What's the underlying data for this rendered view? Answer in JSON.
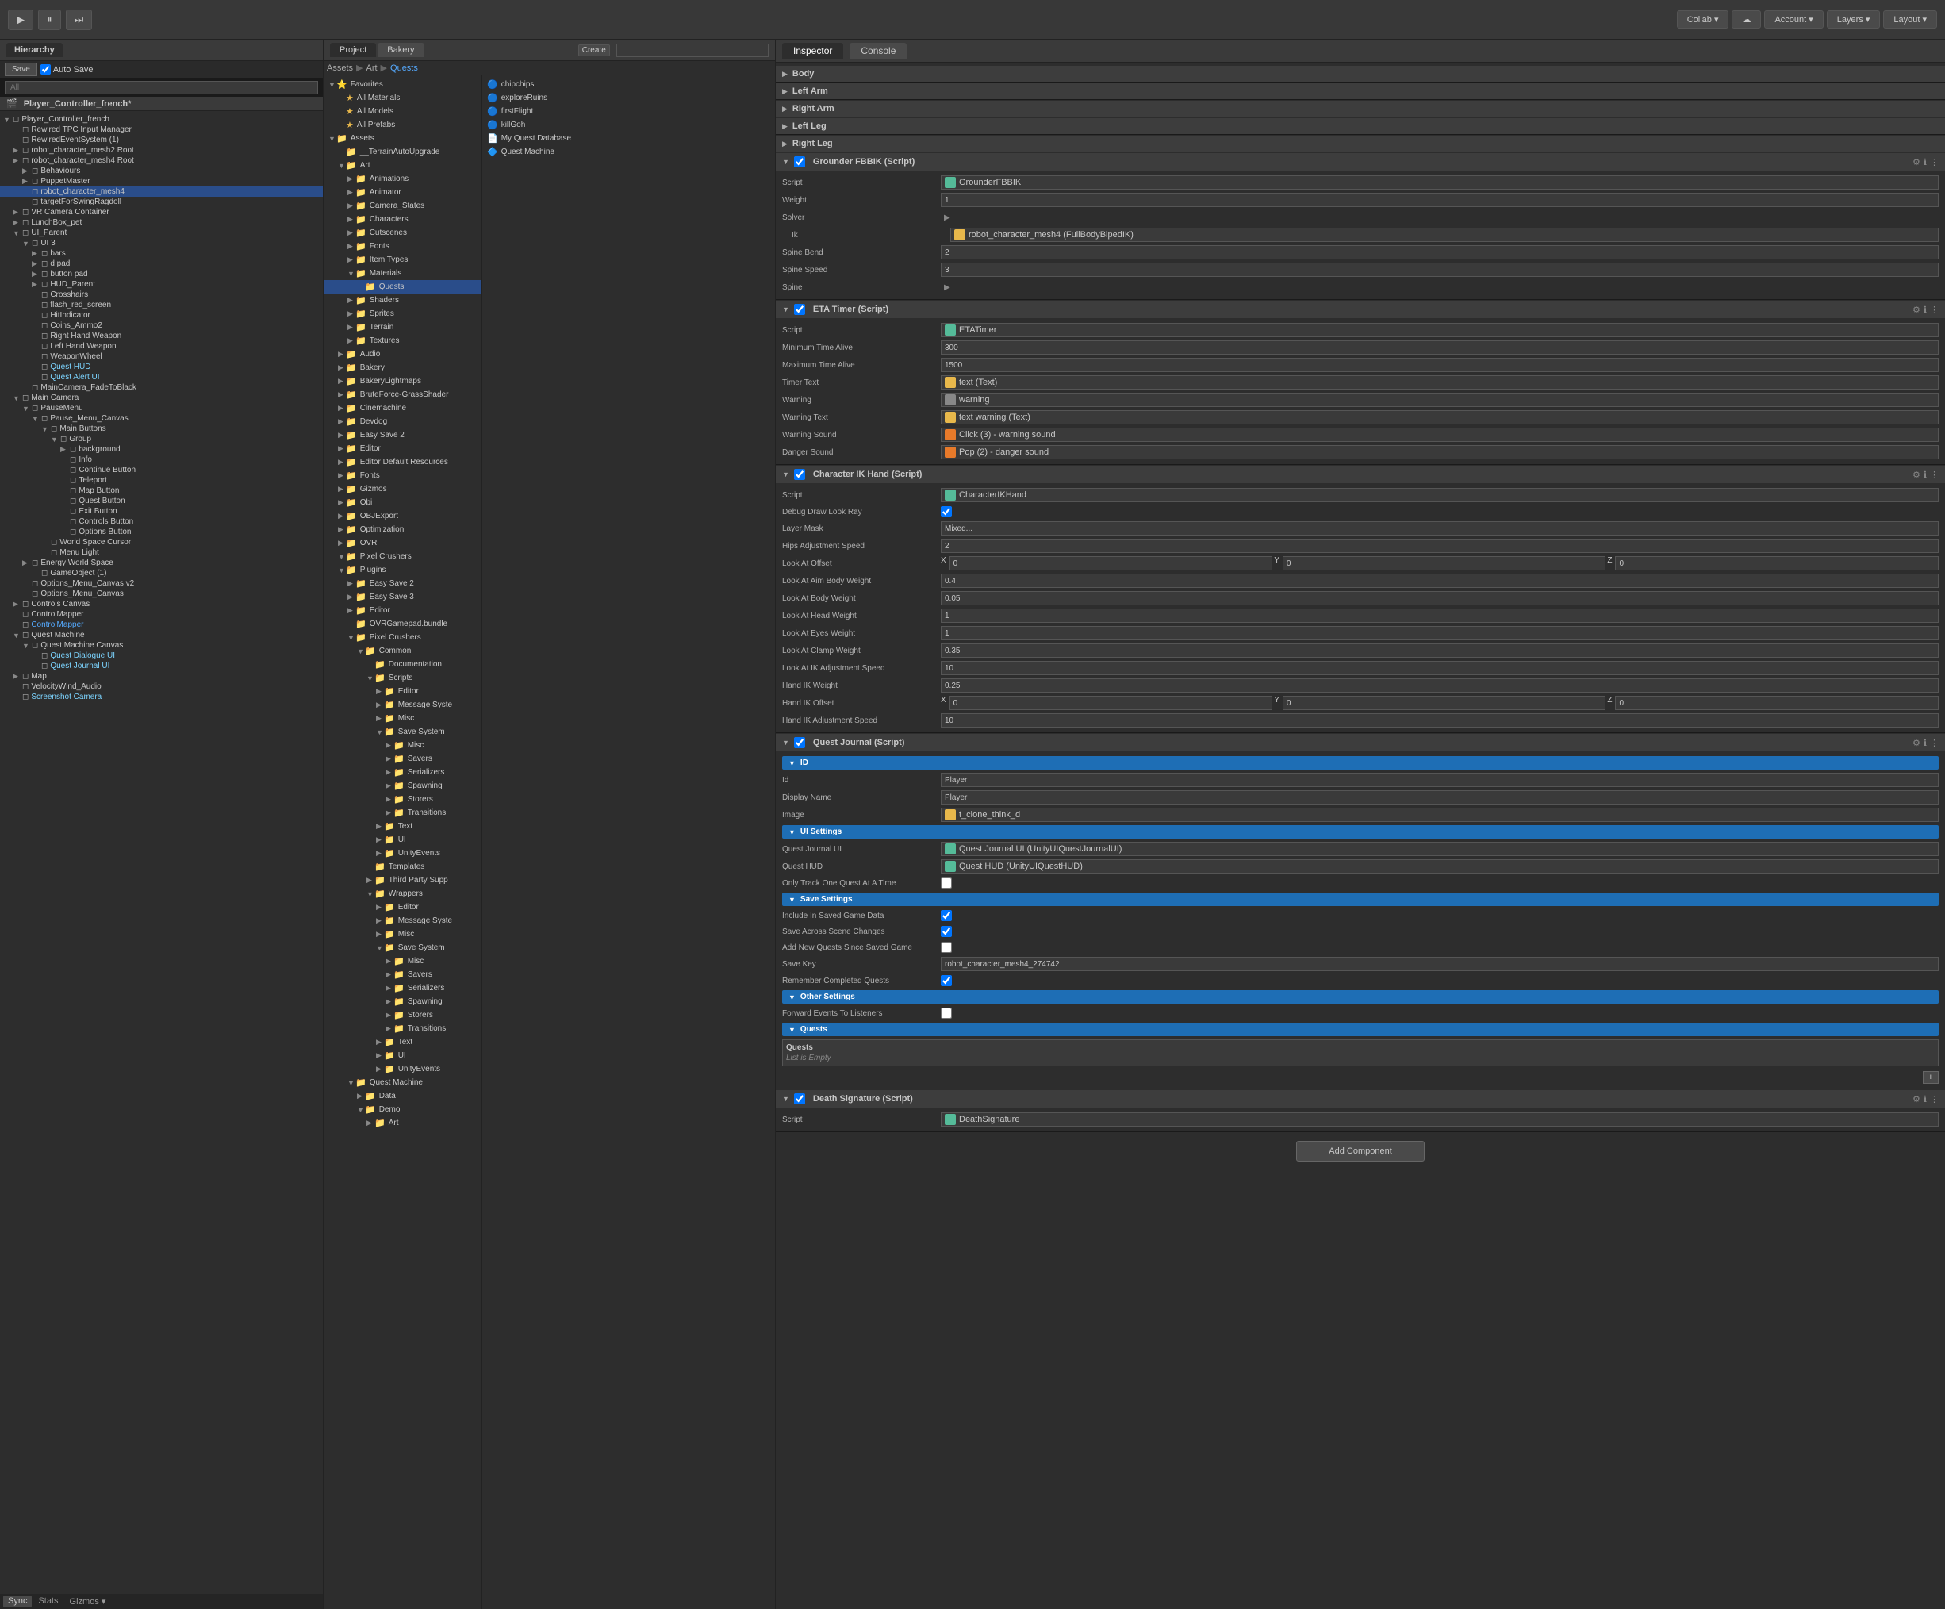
{
  "toolbar": {
    "play_label": "▶",
    "pause_label": "⏸",
    "step_label": "⏭",
    "collab_label": "Collab ▾",
    "cloud_label": "☁",
    "account_label": "Account ▾",
    "layers_label": "Layers ▾",
    "layout_label": "Layout ▾"
  },
  "hierarchy": {
    "title": "Hierarchy",
    "search_placeholder": "All",
    "save_label": "Save",
    "autosave_label": "Auto Save",
    "scene_name": "Player_Controller_french*",
    "items": [
      {
        "level": 0,
        "label": "Player_Controller_french",
        "arrow": "▼",
        "type": "scene"
      },
      {
        "level": 1,
        "label": "Rewired TPC Input Manager",
        "arrow": "",
        "type": "go"
      },
      {
        "level": 1,
        "label": "RewiredEventSystem (1)",
        "arrow": "",
        "type": "go"
      },
      {
        "level": 1,
        "label": "robot_character_mesh2 Root",
        "arrow": "▶",
        "type": "go"
      },
      {
        "level": 1,
        "label": "robot_character_mesh4 Root",
        "arrow": "▶",
        "type": "go"
      },
      {
        "level": 2,
        "label": "Behaviours",
        "arrow": "▶",
        "type": "go"
      },
      {
        "level": 2,
        "label": "PuppetMaster",
        "arrow": "▶",
        "type": "go"
      },
      {
        "level": 2,
        "label": "robot_character_mesh4",
        "arrow": "",
        "type": "go",
        "selected": true
      },
      {
        "level": 2,
        "label": "targetForSwingRagdoll",
        "arrow": "",
        "type": "go"
      },
      {
        "level": 1,
        "label": "VR Camera Container",
        "arrow": "▶",
        "type": "go"
      },
      {
        "level": 1,
        "label": "LunchBox_pet",
        "arrow": "▶",
        "type": "go"
      },
      {
        "level": 1,
        "label": "UI_Parent",
        "arrow": "▼",
        "type": "go"
      },
      {
        "level": 2,
        "label": "UI 3",
        "arrow": "▼",
        "type": "go"
      },
      {
        "level": 3,
        "label": "bars",
        "arrow": "▶",
        "type": "go"
      },
      {
        "level": 3,
        "label": "d pad",
        "arrow": "▶",
        "type": "go"
      },
      {
        "level": 3,
        "label": "button pad",
        "arrow": "▶",
        "type": "go"
      },
      {
        "level": 3,
        "label": "HUD_Parent",
        "arrow": "▶",
        "type": "go"
      },
      {
        "level": 3,
        "label": "Crosshairs",
        "arrow": "",
        "type": "go"
      },
      {
        "level": 3,
        "label": "flash_red_screen",
        "arrow": "",
        "type": "go"
      },
      {
        "level": 3,
        "label": "HitIndicator",
        "arrow": "",
        "type": "go"
      },
      {
        "level": 3,
        "label": "Coins_Ammo2",
        "arrow": "",
        "type": "go"
      },
      {
        "level": 3,
        "label": "Right Hand Weapon",
        "arrow": "",
        "type": "go"
      },
      {
        "level": 3,
        "label": "Left Hand Weapon",
        "arrow": "",
        "type": "go"
      },
      {
        "level": 3,
        "label": "WeaponWheel",
        "arrow": "",
        "type": "go"
      },
      {
        "level": 3,
        "label": "Quest HUD",
        "arrow": "",
        "type": "go",
        "color": "quest"
      },
      {
        "level": 3,
        "label": "Quest Alert UI",
        "arrow": "",
        "type": "go",
        "color": "quest"
      },
      {
        "level": 2,
        "label": "MainCamera_FadeToBlack",
        "arrow": "",
        "type": "go"
      },
      {
        "level": 1,
        "label": "Main Camera",
        "arrow": "▼",
        "type": "go"
      },
      {
        "level": 2,
        "label": "PauseMenu",
        "arrow": "▼",
        "type": "go"
      },
      {
        "level": 3,
        "label": "Pause_Menu_Canvas",
        "arrow": "▼",
        "type": "go"
      },
      {
        "level": 4,
        "label": "Main Buttons",
        "arrow": "▼",
        "type": "go"
      },
      {
        "level": 5,
        "label": "Group",
        "arrow": "▼",
        "type": "go"
      },
      {
        "level": 6,
        "label": "background",
        "arrow": "▶",
        "type": "go"
      },
      {
        "level": 6,
        "label": "Info",
        "arrow": "",
        "type": "go"
      },
      {
        "level": 6,
        "label": "Continue Button",
        "arrow": "",
        "type": "go"
      },
      {
        "level": 6,
        "label": "Teleport",
        "arrow": "",
        "type": "go"
      },
      {
        "level": 6,
        "label": "Map Button",
        "arrow": "",
        "type": "go"
      },
      {
        "level": 6,
        "label": "Quest Button",
        "arrow": "",
        "type": "go"
      },
      {
        "level": 6,
        "label": "Exit Button",
        "arrow": "",
        "type": "go"
      },
      {
        "level": 6,
        "label": "Controls Button",
        "arrow": "",
        "type": "go"
      },
      {
        "level": 6,
        "label": "Options Button",
        "arrow": "",
        "type": "go"
      },
      {
        "level": 4,
        "label": "World Space Cursor",
        "arrow": "",
        "type": "go"
      },
      {
        "level": 4,
        "label": "Menu Light",
        "arrow": "",
        "type": "go"
      },
      {
        "level": 2,
        "label": "Energy World Space",
        "arrow": "▶",
        "type": "go"
      },
      {
        "level": 3,
        "label": "GameObject (1)",
        "arrow": "",
        "type": "go"
      },
      {
        "level": 2,
        "label": "Options_Menu_Canvas v2",
        "arrow": "",
        "type": "go"
      },
      {
        "level": 2,
        "label": "Options_Menu_Canvas",
        "arrow": "",
        "type": "go"
      },
      {
        "level": 1,
        "label": "Controls Canvas",
        "arrow": "▶",
        "type": "go"
      },
      {
        "level": 1,
        "label": "ControlMapper",
        "arrow": "",
        "type": "go"
      },
      {
        "level": 1,
        "label": "ControlMapper",
        "arrow": "",
        "type": "go",
        "color": "highlight"
      },
      {
        "level": 1,
        "label": "Quest Machine",
        "arrow": "▼",
        "type": "go"
      },
      {
        "level": 2,
        "label": "Quest Machine Canvas",
        "arrow": "▼",
        "type": "go"
      },
      {
        "level": 3,
        "label": "Quest Dialogue UI",
        "arrow": "",
        "type": "go",
        "color": "quest"
      },
      {
        "level": 3,
        "label": "Quest Journal UI",
        "arrow": "",
        "type": "go",
        "color": "quest"
      },
      {
        "level": 1,
        "label": "Map",
        "arrow": "▶",
        "type": "go"
      },
      {
        "level": 1,
        "label": "VelocityWind_Audio",
        "arrow": "",
        "type": "go"
      },
      {
        "level": 1,
        "label": "Screenshot Camera",
        "arrow": "",
        "type": "go",
        "color": "quest"
      }
    ]
  },
  "project": {
    "title": "Project",
    "bakery_label": "Bakery",
    "search_placeholder": "",
    "create_label": "Create",
    "breadcrumb": [
      "Assets",
      "Art",
      "Quests"
    ],
    "favorites": {
      "label": "Favorites",
      "items": [
        {
          "label": "All Materials",
          "icon": "★"
        },
        {
          "label": "All Models",
          "icon": "★"
        },
        {
          "label": "All Prefabs",
          "icon": "★"
        }
      ]
    },
    "assets_tree": [
      {
        "label": "Assets",
        "level": 0,
        "arrow": "▼"
      },
      {
        "label": "__TerrainAutoUpgrade",
        "level": 1,
        "arrow": ""
      },
      {
        "label": "Art",
        "level": 1,
        "arrow": "▼"
      },
      {
        "label": "Animations",
        "level": 2,
        "arrow": "▶"
      },
      {
        "label": "Animator",
        "level": 2,
        "arrow": "▶"
      },
      {
        "label": "Camera_States",
        "level": 2,
        "arrow": "▶"
      },
      {
        "label": "Characters",
        "level": 2,
        "arrow": "▶"
      },
      {
        "label": "Cutscenes",
        "level": 2,
        "arrow": "▶"
      },
      {
        "label": "Fonts",
        "level": 2,
        "arrow": "▶"
      },
      {
        "label": "Item Types",
        "level": 2,
        "arrow": "▶"
      },
      {
        "label": "Materials",
        "level": 2,
        "arrow": "▼"
      },
      {
        "label": "Quests",
        "level": 3,
        "arrow": "",
        "selected": true
      },
      {
        "label": "Shaders",
        "level": 2,
        "arrow": "▶"
      },
      {
        "label": "Sprites",
        "level": 2,
        "arrow": "▶"
      },
      {
        "label": "Terrain",
        "level": 2,
        "arrow": "▶"
      },
      {
        "label": "Textures",
        "level": 2,
        "arrow": "▶"
      },
      {
        "label": "Audio",
        "level": 1,
        "arrow": "▶"
      },
      {
        "label": "Bakery",
        "level": 1,
        "arrow": "▶"
      },
      {
        "label": "BakeryLightmaps",
        "level": 1,
        "arrow": "▶"
      },
      {
        "label": "BruteForce-GrassShader",
        "level": 1,
        "arrow": "▶"
      },
      {
        "label": "Cinemachine",
        "level": 1,
        "arrow": "▶"
      },
      {
        "label": "Devdog",
        "level": 1,
        "arrow": "▶"
      },
      {
        "label": "Easy Save 2",
        "level": 1,
        "arrow": "▶"
      },
      {
        "label": "Editor",
        "level": 1,
        "arrow": "▶"
      },
      {
        "label": "Editor Default Resources",
        "level": 1,
        "arrow": "▶"
      },
      {
        "label": "Fonts",
        "level": 1,
        "arrow": "▶"
      },
      {
        "label": "Gizmos",
        "level": 1,
        "arrow": "▶"
      },
      {
        "label": "Obi",
        "level": 1,
        "arrow": "▶"
      },
      {
        "label": "OBJExport",
        "level": 1,
        "arrow": "▶"
      },
      {
        "label": "Optimization",
        "level": 1,
        "arrow": "▶"
      },
      {
        "label": "OVR",
        "level": 1,
        "arrow": "▶"
      },
      {
        "label": "Pixel Crushers",
        "level": 1,
        "arrow": "▼"
      },
      {
        "label": "Plugins",
        "level": 1,
        "arrow": "▼"
      },
      {
        "label": "Easy Save 2",
        "level": 2,
        "arrow": "▶"
      },
      {
        "label": "Easy Save 3",
        "level": 2,
        "arrow": "▶"
      },
      {
        "label": "Editor",
        "level": 2,
        "arrow": "▶"
      },
      {
        "label": "OVRGamepad.bundle",
        "level": 2,
        "arrow": ""
      },
      {
        "label": "Pixel Crushers",
        "level": 2,
        "arrow": "▼"
      },
      {
        "label": "Common",
        "level": 3,
        "arrow": "▼"
      },
      {
        "label": "Documentation",
        "level": 4,
        "arrow": ""
      },
      {
        "label": "Scripts",
        "level": 4,
        "arrow": "▼"
      },
      {
        "label": "Editor",
        "level": 5,
        "arrow": "▶"
      },
      {
        "label": "Message Syste",
        "level": 5,
        "arrow": "▶"
      },
      {
        "label": "Misc",
        "level": 5,
        "arrow": "▶"
      },
      {
        "label": "Save System",
        "level": 5,
        "arrow": "▼"
      },
      {
        "label": "Misc",
        "level": 6,
        "arrow": "▶"
      },
      {
        "label": "Savers",
        "level": 6,
        "arrow": "▶"
      },
      {
        "label": "Serializers",
        "level": 6,
        "arrow": "▶"
      },
      {
        "label": "Spawning",
        "level": 6,
        "arrow": "▶"
      },
      {
        "label": "Storers",
        "level": 6,
        "arrow": "▶"
      },
      {
        "label": "Transitions",
        "level": 6,
        "arrow": "▶"
      },
      {
        "label": "Text",
        "level": 5,
        "arrow": "▶"
      },
      {
        "label": "UI",
        "level": 5,
        "arrow": "▶"
      },
      {
        "label": "UnityEvents",
        "level": 5,
        "arrow": "▶"
      },
      {
        "label": "Templates",
        "level": 4,
        "arrow": ""
      },
      {
        "label": "Third Party Supp",
        "level": 4,
        "arrow": "▶"
      },
      {
        "label": "Wrappers",
        "level": 4,
        "arrow": "▼"
      },
      {
        "label": "Editor",
        "level": 5,
        "arrow": "▶"
      },
      {
        "label": "Message Syste",
        "level": 5,
        "arrow": "▶"
      },
      {
        "label": "Misc",
        "level": 5,
        "arrow": "▶"
      },
      {
        "label": "Save System",
        "level": 5,
        "arrow": "▼"
      },
      {
        "label": "Misc",
        "level": 6,
        "arrow": "▶"
      },
      {
        "label": "Savers",
        "level": 6,
        "arrow": "▶"
      },
      {
        "label": "Serializers",
        "level": 6,
        "arrow": "▶"
      },
      {
        "label": "Spawning",
        "level": 6,
        "arrow": "▶"
      },
      {
        "label": "Storers",
        "level": 6,
        "arrow": "▶"
      },
      {
        "label": "Transitions",
        "level": 6,
        "arrow": "▶"
      },
      {
        "label": "Text",
        "level": 5,
        "arrow": "▶"
      },
      {
        "label": "UI",
        "level": 5,
        "arrow": "▶"
      },
      {
        "label": "UnityEvents",
        "level": 5,
        "arrow": "▶"
      },
      {
        "label": "Quest Machine",
        "level": 2,
        "arrow": "▼"
      },
      {
        "label": "Data",
        "level": 3,
        "arrow": "▶"
      },
      {
        "label": "Demo",
        "level": 3,
        "arrow": "▼"
      },
      {
        "label": "Art",
        "level": 4,
        "arrow": "▶"
      }
    ],
    "right_panel_items": [
      {
        "label": "chipchips",
        "icon": "🔵"
      },
      {
        "label": "exploreRuins",
        "icon": "🔵"
      },
      {
        "label": "firstFlight",
        "icon": "🔵"
      },
      {
        "label": "killGoh",
        "icon": "🔵"
      },
      {
        "label": "My Quest Database",
        "icon": "📄"
      },
      {
        "label": "Quest Machine",
        "icon": "🔷"
      }
    ]
  },
  "inspector": {
    "title": "Inspector",
    "console_label": "Console",
    "components": [
      {
        "id": "body",
        "title": "Body",
        "expanded": false
      },
      {
        "id": "left_arm",
        "title": "Left Arm",
        "expanded": false
      },
      {
        "id": "right_arm",
        "title": "Right Arm",
        "expanded": false
      },
      {
        "id": "left_leg",
        "title": "Left Leg",
        "expanded": false
      },
      {
        "id": "right_leg",
        "title": "Right Leg",
        "expanded": false
      },
      {
        "id": "grounder_fbbik",
        "title": "Grounder FBBIK (Script)",
        "expanded": true,
        "script": "GrounderFBBIK",
        "weight": "1",
        "solver_label": "Solver",
        "ik_value": "robot_character_mesh4 (FullBodyBipedIK)",
        "spine_bend": "2",
        "spine_speed": "3",
        "spine_label": "Spine"
      },
      {
        "id": "eta_timer",
        "title": "ETA Timer (Script)",
        "expanded": true,
        "script": "ETATimer",
        "min_time_alive": "300",
        "max_time_alive": "1500",
        "timer_text": "text (Text)",
        "warning": "warning",
        "warning_text": "text warning (Text)",
        "warning_sound": "Click (3) - warning sound",
        "danger_sound": "Pop (2) - danger sound"
      },
      {
        "id": "character_ik_hand",
        "title": "Character IK Hand (Script)",
        "expanded": true,
        "script": "CharacterIKHand",
        "debug_draw_look_ray": true,
        "layer_mask": "Mixed...",
        "hips_adjustment_speed": "2",
        "look_at_offset_x": "0",
        "look_at_offset_y": "0",
        "look_at_offset_z": "0",
        "look_at_aim_body_weight": "0.4",
        "look_at_body_weight": "0.05",
        "look_at_head_weight": "1",
        "look_at_eyes_weight": "1",
        "look_at_clamp_weight": "0.35",
        "look_at_ik_adjustment_speed": "10",
        "hand_ik_weight": "0.25",
        "hand_ik_offset_x": "0",
        "hand_ik_offset_y": "0",
        "hand_ik_offset_z": "0",
        "hand_ik_adjustment_speed": "10"
      },
      {
        "id": "quest_journal",
        "title": "Quest Journal (Script)",
        "expanded": true,
        "sections": {
          "id": {
            "label": "ID",
            "id_value": "Player",
            "display_name": "Player",
            "image": "t_clone_think_d"
          },
          "ui_settings": {
            "label": "UI Settings",
            "quest_journal_ui": "Quest Journal UI (UnityUIQuestJournalUI)",
            "quest_hud": "Quest HUD (UnityUIQuestHUD)",
            "only_track_one": false
          },
          "save_settings": {
            "label": "Save Settings",
            "include_saved": true,
            "save_across_scenes": true,
            "add_new_quests": false,
            "save_key": "robot_character_mesh4_274742",
            "remember_completed": true
          },
          "other_settings": {
            "label": "Other Settings",
            "forward_events": false
          },
          "quests": {
            "label": "Quests",
            "quests_sub_label": "Quests",
            "list_empty": "List is Empty"
          }
        }
      },
      {
        "id": "death_signature",
        "title": "Death Signature (Script)",
        "expanded": true,
        "script": "DeathSignature"
      }
    ],
    "add_component_label": "Add Component"
  },
  "layers_panel": {
    "title": "Layers"
  },
  "colors": {
    "accent_blue": "#2a4d8a",
    "section_blue": "#1e6eb5",
    "quest_color": "#7cd4ff",
    "highlight_color": "#55aaff",
    "folder_yellow": "#e8b84b"
  }
}
